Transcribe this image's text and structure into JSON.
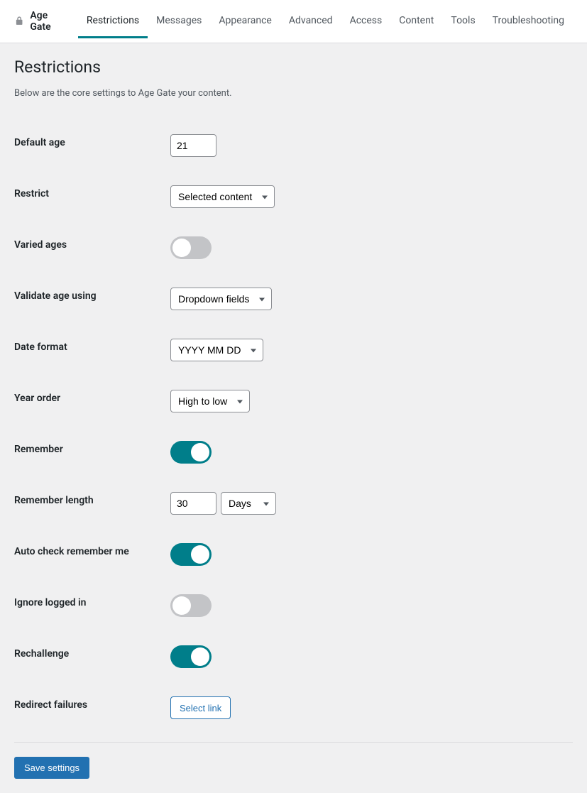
{
  "header": {
    "title": "Age Gate",
    "tabs": [
      {
        "label": "Restrictions",
        "active": true
      },
      {
        "label": "Messages",
        "active": false
      },
      {
        "label": "Appearance",
        "active": false
      },
      {
        "label": "Advanced",
        "active": false
      },
      {
        "label": "Access",
        "active": false
      },
      {
        "label": "Content",
        "active": false
      },
      {
        "label": "Tools",
        "active": false
      },
      {
        "label": "Troubleshooting",
        "active": false
      }
    ]
  },
  "page": {
    "title": "Restrictions",
    "description": "Below are the core settings to Age Gate your content."
  },
  "fields": {
    "default_age": {
      "label": "Default age",
      "value": "21"
    },
    "restrict": {
      "label": "Restrict",
      "selected": "Selected content"
    },
    "varied_ages": {
      "label": "Varied ages",
      "on": false
    },
    "validate_age_using": {
      "label": "Validate age using",
      "selected": "Dropdown fields"
    },
    "date_format": {
      "label": "Date format",
      "selected": "YYYY MM DD"
    },
    "year_order": {
      "label": "Year order",
      "selected": "High to low"
    },
    "remember": {
      "label": "Remember",
      "on": true
    },
    "remember_length": {
      "label": "Remember length",
      "value": "30",
      "unit": "Days"
    },
    "auto_check_remember": {
      "label": "Auto check remember me",
      "on": true
    },
    "ignore_logged_in": {
      "label": "Ignore logged in",
      "on": false
    },
    "rechallenge": {
      "label": "Rechallenge",
      "on": true
    },
    "redirect_failures": {
      "label": "Redirect failures",
      "button": "Select link"
    }
  },
  "actions": {
    "save": "Save settings"
  }
}
